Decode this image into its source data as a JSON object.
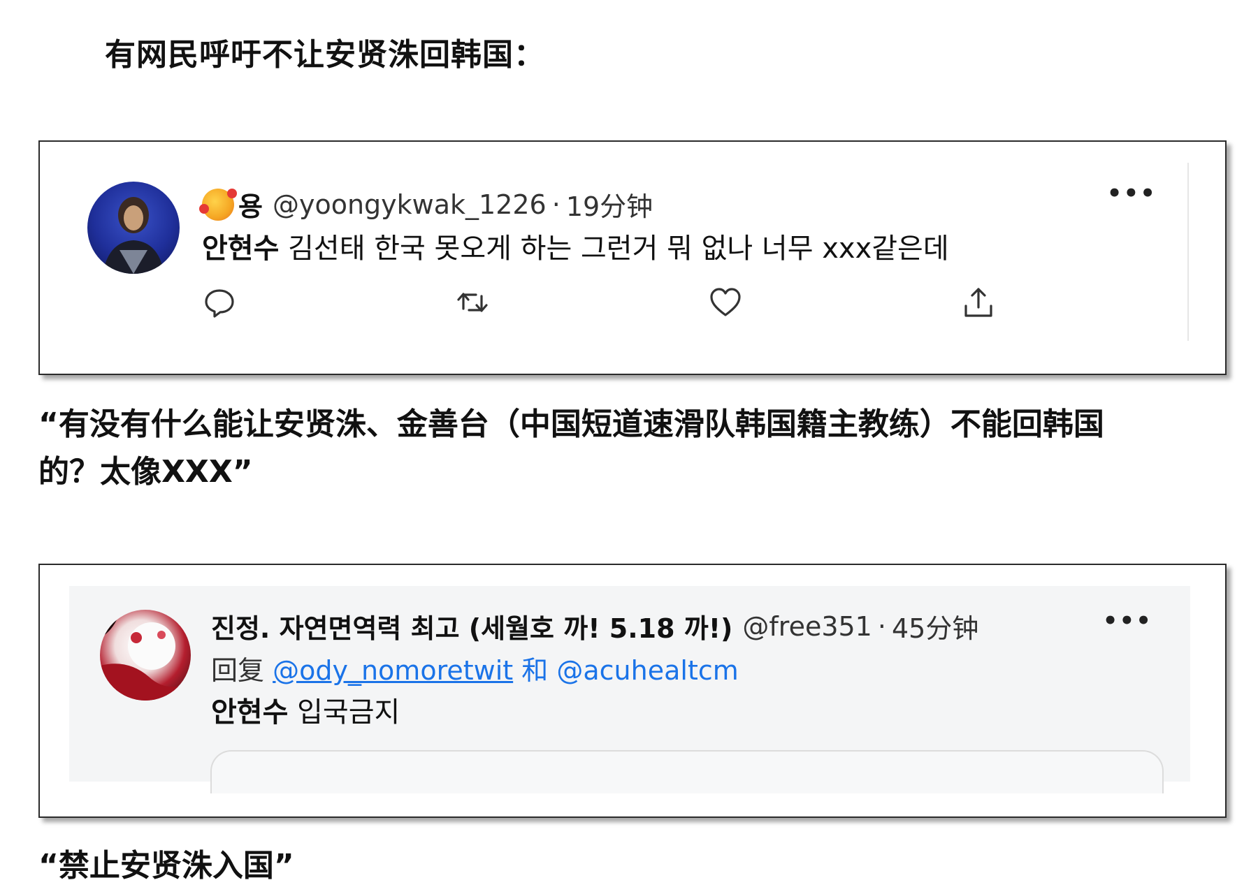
{
  "heading": "有网民呼吁不让安贤洙回韩国：",
  "tweet1": {
    "display_name": "용",
    "handle": "@yoongykwak_1226",
    "separator": "·",
    "time": "19分钟",
    "more": "•••",
    "text_bold": "안현수",
    "text_rest": " 김선태 한국 못오게 하는 그런거 뭐 없나 너무 xxx같은데",
    "actions": [
      "reply-icon",
      "retweet-icon",
      "like-icon",
      "share-icon"
    ]
  },
  "quote1": {
    "line1": "“有没有什么能让安贤洙、金善台（中国短道速滑队韩国籍主教练）不能回韩国",
    "line2": "的？太像XXX”"
  },
  "tweet2": {
    "display_name": "진정. 자연면역력 최고 (세월호 까! 5.18 까!)",
    "handle": "@free351",
    "separator": "·",
    "time": "45分钟",
    "more": "•••",
    "reply_prefix": "回复",
    "reply_mention1": "@ody_nomoretwit",
    "reply_and": "和",
    "reply_mention2": "@acuhealtcm",
    "text_bold": "안현수",
    "text_rest": " 입국금지"
  },
  "quote2": {
    "text": "“禁止安贤洙入国”"
  },
  "colors": {
    "mention": "#1a73e8",
    "border": "#2b2b2b"
  }
}
